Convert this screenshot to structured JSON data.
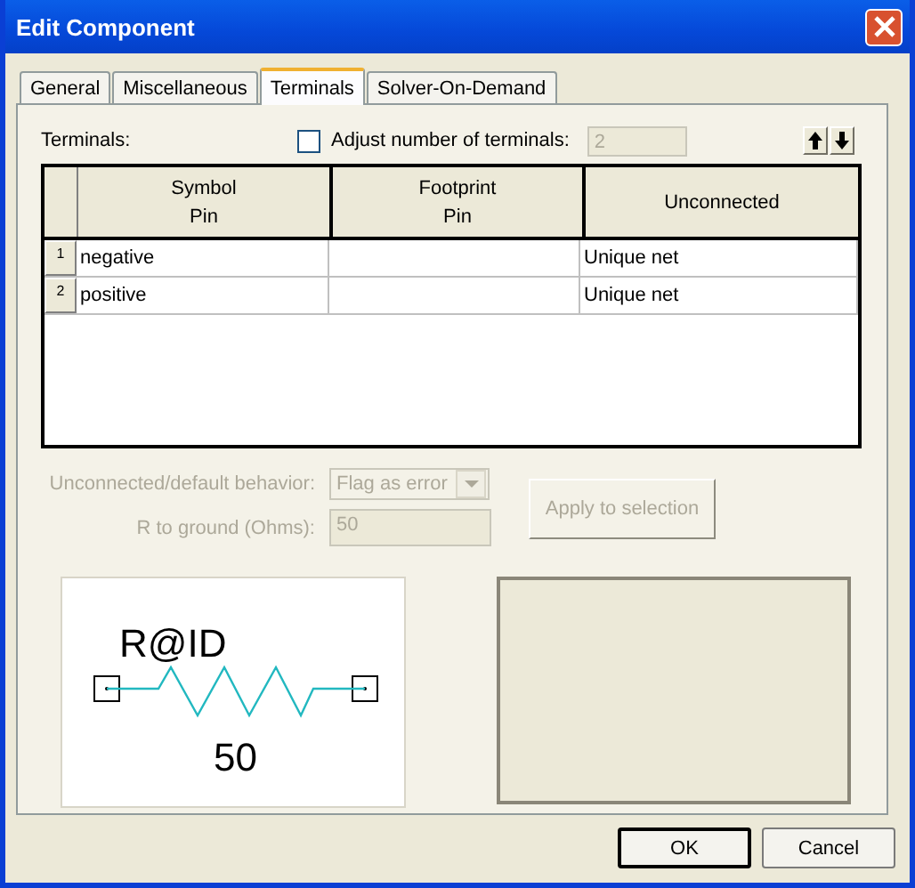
{
  "window": {
    "title": "Edit Component"
  },
  "tabs": [
    {
      "label": "General",
      "selected": false
    },
    {
      "label": "Miscellaneous",
      "selected": false
    },
    {
      "label": "Terminals",
      "selected": true
    },
    {
      "label": "Solver-On-Demand",
      "selected": false
    }
  ],
  "terminals_label": "Terminals:",
  "adjust": {
    "label": "Adjust number of terminals:",
    "checked": false,
    "value": "2",
    "disabled": true
  },
  "grid": {
    "columns": [
      {
        "lines": [
          "Symbol",
          "Pin"
        ]
      },
      {
        "lines": [
          "Footprint",
          "Pin"
        ]
      },
      {
        "lines": [
          "Unconnected"
        ]
      }
    ],
    "rows": [
      {
        "number": "1",
        "cells": [
          "negative",
          "",
          "Unique net"
        ]
      },
      {
        "number": "2",
        "cells": [
          "positive",
          "",
          "Unique net"
        ]
      }
    ]
  },
  "behavior": {
    "label": "Unconnected/default behavior:",
    "value": "Flag as error",
    "disabled": true
  },
  "r_ground": {
    "label": "R to ground (Ohms):",
    "value": "50",
    "disabled": true
  },
  "apply": {
    "label": "Apply to selection",
    "disabled": true
  },
  "preview": {
    "ref_label": "R@ID",
    "value_label": "50"
  },
  "buttons": [
    {
      "label": "OK",
      "default": true
    },
    {
      "label": "Cancel",
      "default": false
    }
  ]
}
